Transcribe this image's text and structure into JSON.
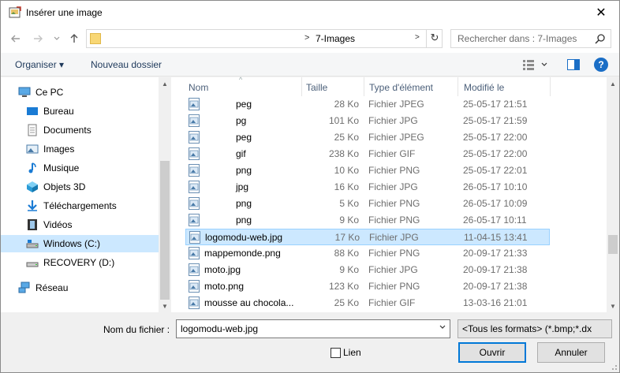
{
  "window": {
    "title": "Insérer une image",
    "close_glyph": "✕"
  },
  "address": {
    "path_current": "7-Images",
    "search_placeholder": "Rechercher dans : 7-Images"
  },
  "toolbar": {
    "organize_label": "Organiser ▾",
    "new_folder_label": "Nouveau dossier",
    "help_glyph": "?"
  },
  "nav": {
    "items": [
      {
        "label": "Ce PC",
        "icon": "pc-icon"
      },
      {
        "label": "Bureau",
        "icon": "desktop-icon"
      },
      {
        "label": "Documents",
        "icon": "documents-icon"
      },
      {
        "label": "Images",
        "icon": "pictures-icon"
      },
      {
        "label": "Musique",
        "icon": "music-icon"
      },
      {
        "label": "Objets 3D",
        "icon": "3d-objects-icon"
      },
      {
        "label": "Téléchargements",
        "icon": "downloads-icon"
      },
      {
        "label": "Vidéos",
        "icon": "videos-icon"
      },
      {
        "label": "Windows (C:)",
        "icon": "drive-c-icon"
      },
      {
        "label": "RECOVERY (D:)",
        "icon": "drive-d-icon"
      },
      {
        "label": "Réseau",
        "icon": "network-icon"
      }
    ]
  },
  "columns": {
    "name": "Nom",
    "size": "Taille",
    "type": "Type d'élément",
    "modified": "Modifié le"
  },
  "files": [
    {
      "name": "peg",
      "size": "28 Ko",
      "type": "Fichier JPEG",
      "modified": "25-05-17 21:51"
    },
    {
      "name": "pg",
      "size": "101 Ko",
      "type": "Fichier JPG",
      "modified": "25-05-17 21:59"
    },
    {
      "name": "peg",
      "size": "25 Ko",
      "type": "Fichier JPEG",
      "modified": "25-05-17 22:00"
    },
    {
      "name": "gif",
      "size": "238 Ko",
      "type": "Fichier GIF",
      "modified": "25-05-17 22:00"
    },
    {
      "name": "png",
      "size": "10 Ko",
      "type": "Fichier PNG",
      "modified": "25-05-17 22:01"
    },
    {
      "name": "jpg",
      "size": "16 Ko",
      "type": "Fichier JPG",
      "modified": "26-05-17 10:10"
    },
    {
      "name": "png",
      "size": "5 Ko",
      "type": "Fichier PNG",
      "modified": "26-05-17 10:09"
    },
    {
      "name": "png",
      "size": "9 Ko",
      "type": "Fichier PNG",
      "modified": "26-05-17 10:11"
    },
    {
      "name": "logomodu-web.jpg",
      "size": "17 Ko",
      "type": "Fichier JPG",
      "modified": "11-04-15 13:41"
    },
    {
      "name": "mappemonde.png",
      "size": "88 Ko",
      "type": "Fichier PNG",
      "modified": "20-09-17 21:33"
    },
    {
      "name": "moto.jpg",
      "size": "9 Ko",
      "type": "Fichier JPG",
      "modified": "20-09-17 21:38"
    },
    {
      "name": "moto.png",
      "size": "123 Ko",
      "type": "Fichier PNG",
      "modified": "20-09-17 21:38"
    },
    {
      "name": "mousse au chocola...",
      "size": "25 Ko",
      "type": "Fichier GIF",
      "modified": "13-03-16 21:01"
    }
  ],
  "selected_index": 8,
  "bottom": {
    "filename_label": "Nom du fichier :",
    "filename_value": "logomodu-web.jpg",
    "filter_value": "<Tous les formats> (*.bmp;*.dx",
    "link_label": "Lien",
    "open_label": "Ouvrir",
    "cancel_label": "Annuler"
  },
  "colors": {
    "selection": "#cce8ff",
    "accent": "#0078d7",
    "help": "#1a6ec6"
  }
}
